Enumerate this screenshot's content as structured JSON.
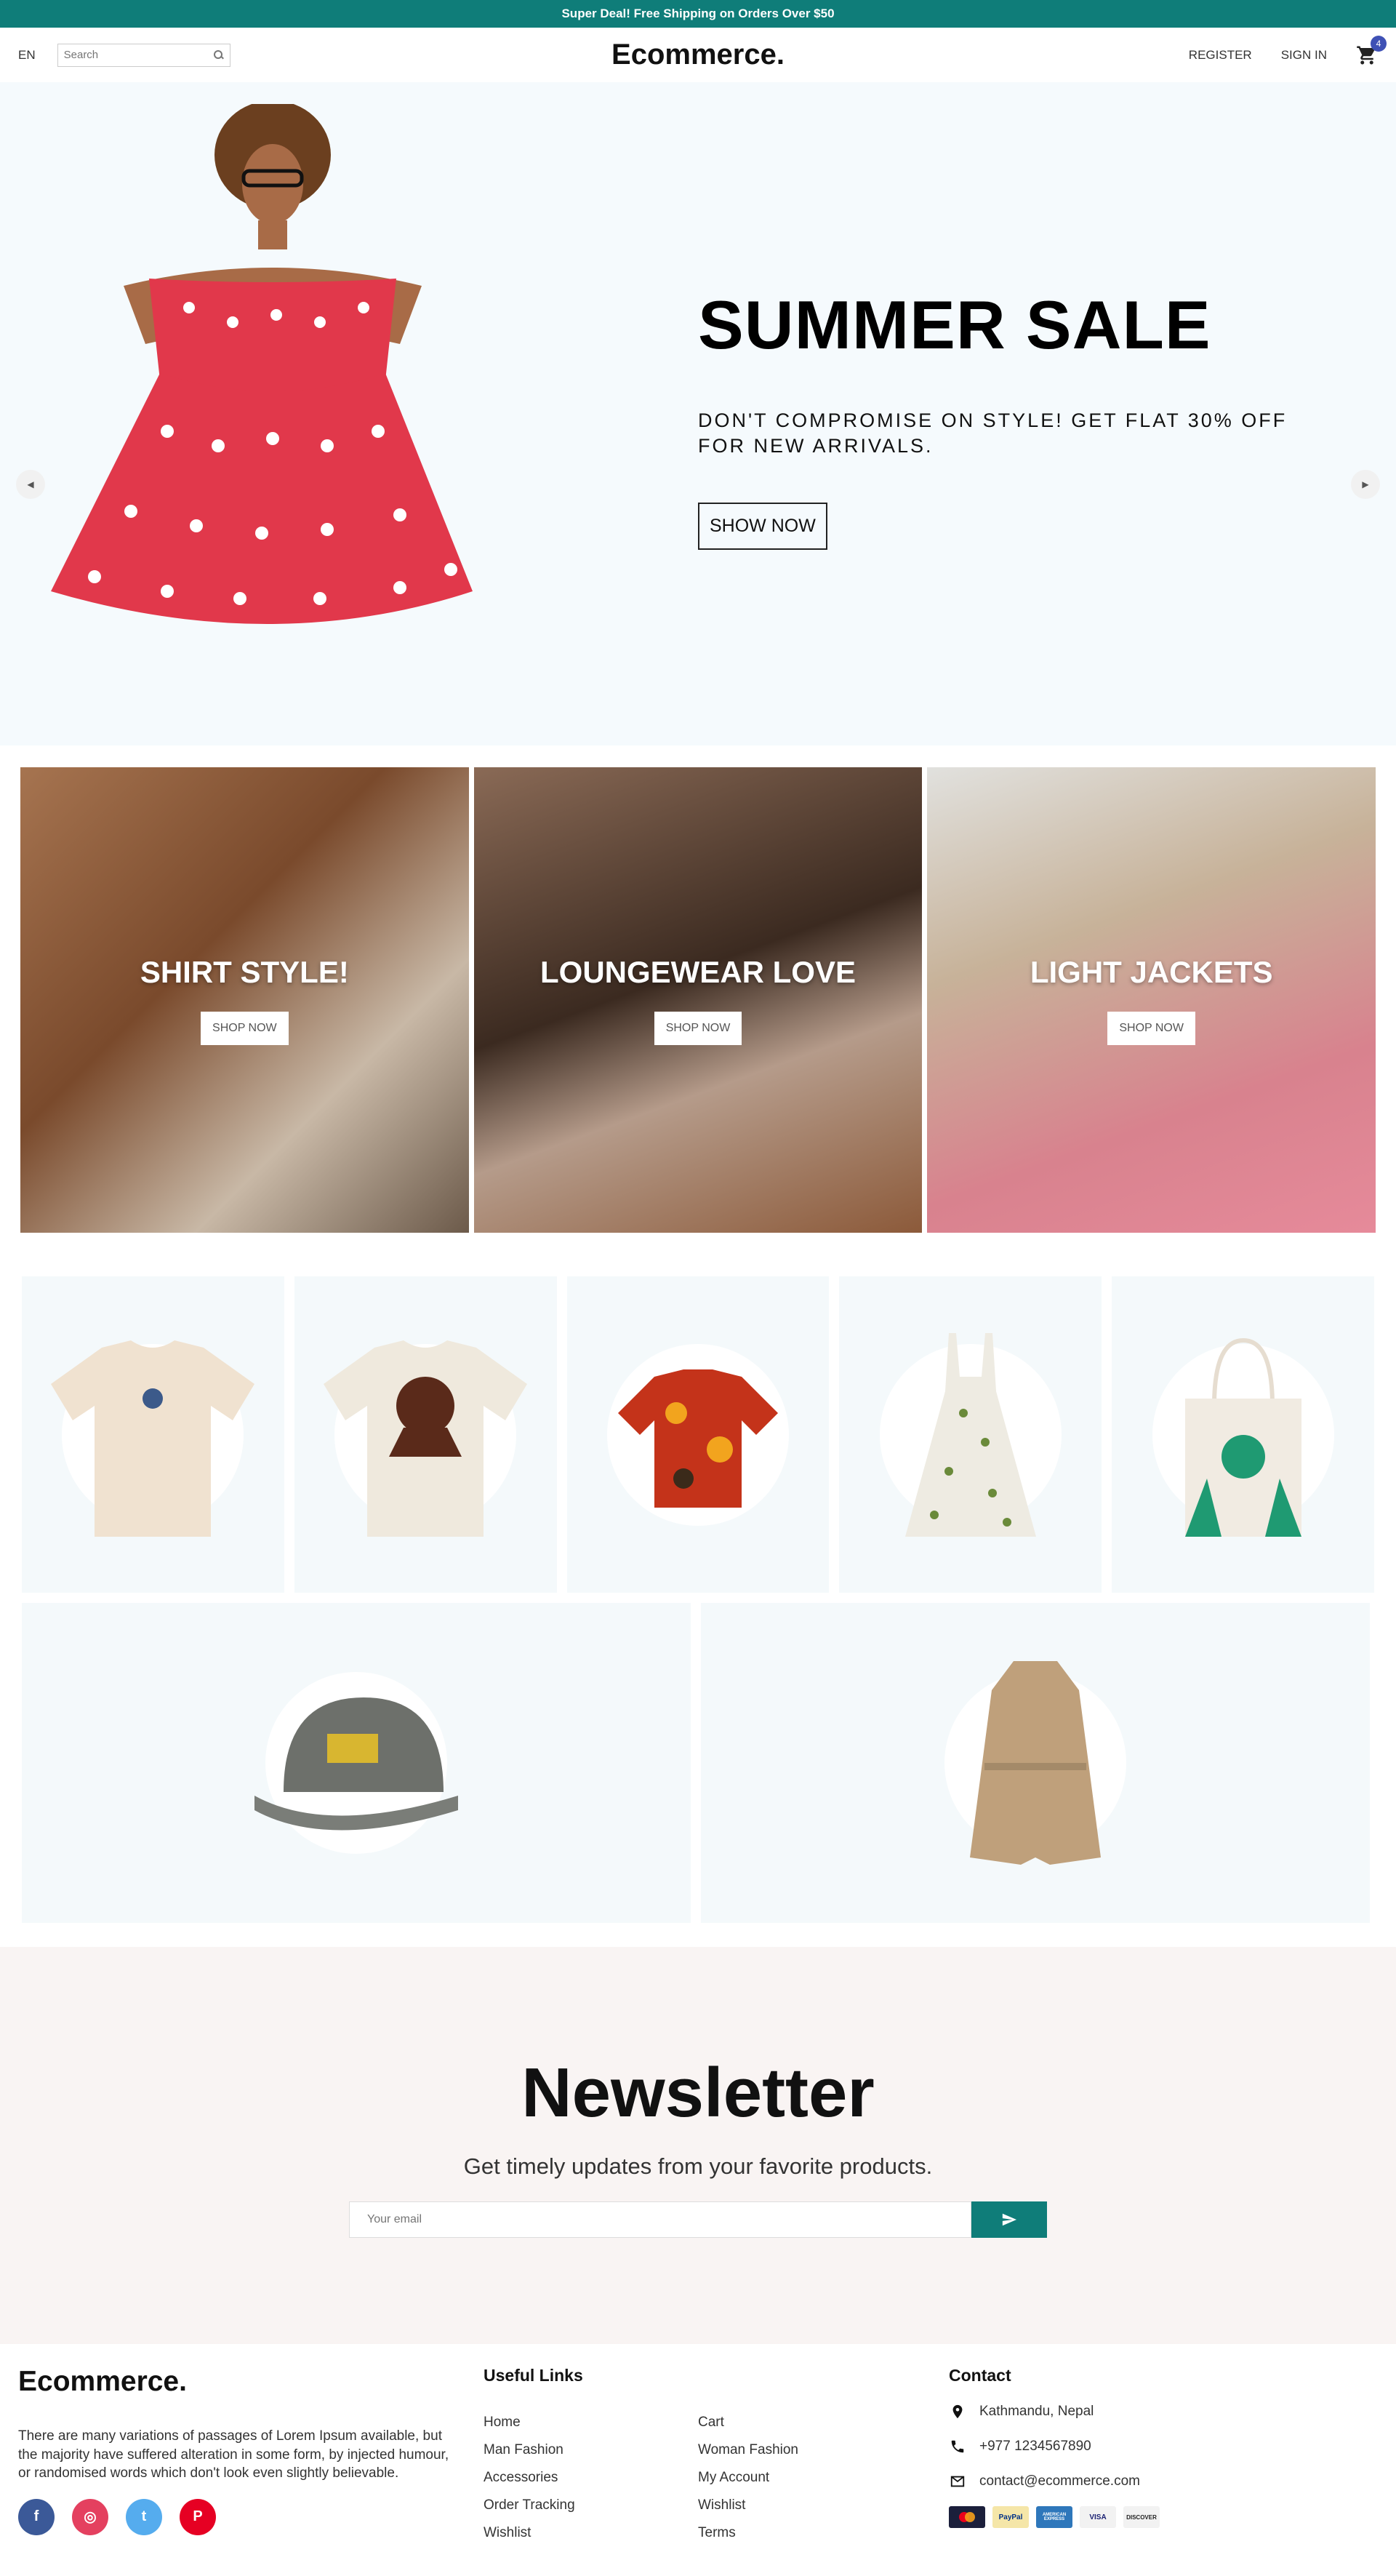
{
  "announcement": "Super Deal! Free Shipping on Orders Over $50",
  "nav": {
    "language": "EN",
    "search_placeholder": "Search",
    "logo": "Ecommerce.",
    "register": "REGISTER",
    "signin": "SIGN IN",
    "cart_count": "4"
  },
  "hero": {
    "title": "SUMMER SALE",
    "description": "DON'T COMPROMISE ON STYLE! GET FLAT 30% OFF FOR NEW ARRIVALS.",
    "button": "SHOW NOW"
  },
  "categories": [
    {
      "title": "SHIRT STYLE!",
      "button": "SHOP NOW"
    },
    {
      "title": "LOUNGEWEAR LOVE",
      "button": "SHOP NOW"
    },
    {
      "title": "LIGHT JACKETS",
      "button": "SHOP NOW"
    }
  ],
  "products": [
    {
      "name": "tshirt-guitar"
    },
    {
      "name": "tshirt-portrait"
    },
    {
      "name": "hawaiian-shirt"
    },
    {
      "name": "floral-dress"
    },
    {
      "name": "tote-bag"
    },
    {
      "name": "cap"
    },
    {
      "name": "trench-coat"
    }
  ],
  "newsletter": {
    "title": "Newsletter",
    "subtitle": "Get timely updates from your favorite products.",
    "placeholder": "Your email"
  },
  "footer": {
    "logo": "Ecommerce.",
    "description": "There are many variations of passages of Lorem Ipsum available, but the majority have suffered alteration in some form, by injected humour, or randomised words which don't look even slightly believable.",
    "useful_links_title": "Useful Links",
    "links": [
      "Home",
      "Cart",
      "Man Fashion",
      "Woman Fashion",
      "Accessories",
      "My Account",
      "Order Tracking",
      "Wishlist",
      "Wishlist",
      "Terms"
    ],
    "contact_title": "Contact",
    "address": "Kathmandu, Nepal",
    "phone": "+977 1234567890",
    "email": "contact@ecommerce.com",
    "payments": [
      "MasterCard",
      "PayPal",
      "AMERICAN EXPRESS",
      "VISA",
      "DISCOVER"
    ]
  },
  "colors": {
    "accent": "#0f7d79",
    "hero_bg": "#f5fafd",
    "newsletter_bg": "#f9f4f3",
    "badge": "#3f51b5"
  }
}
